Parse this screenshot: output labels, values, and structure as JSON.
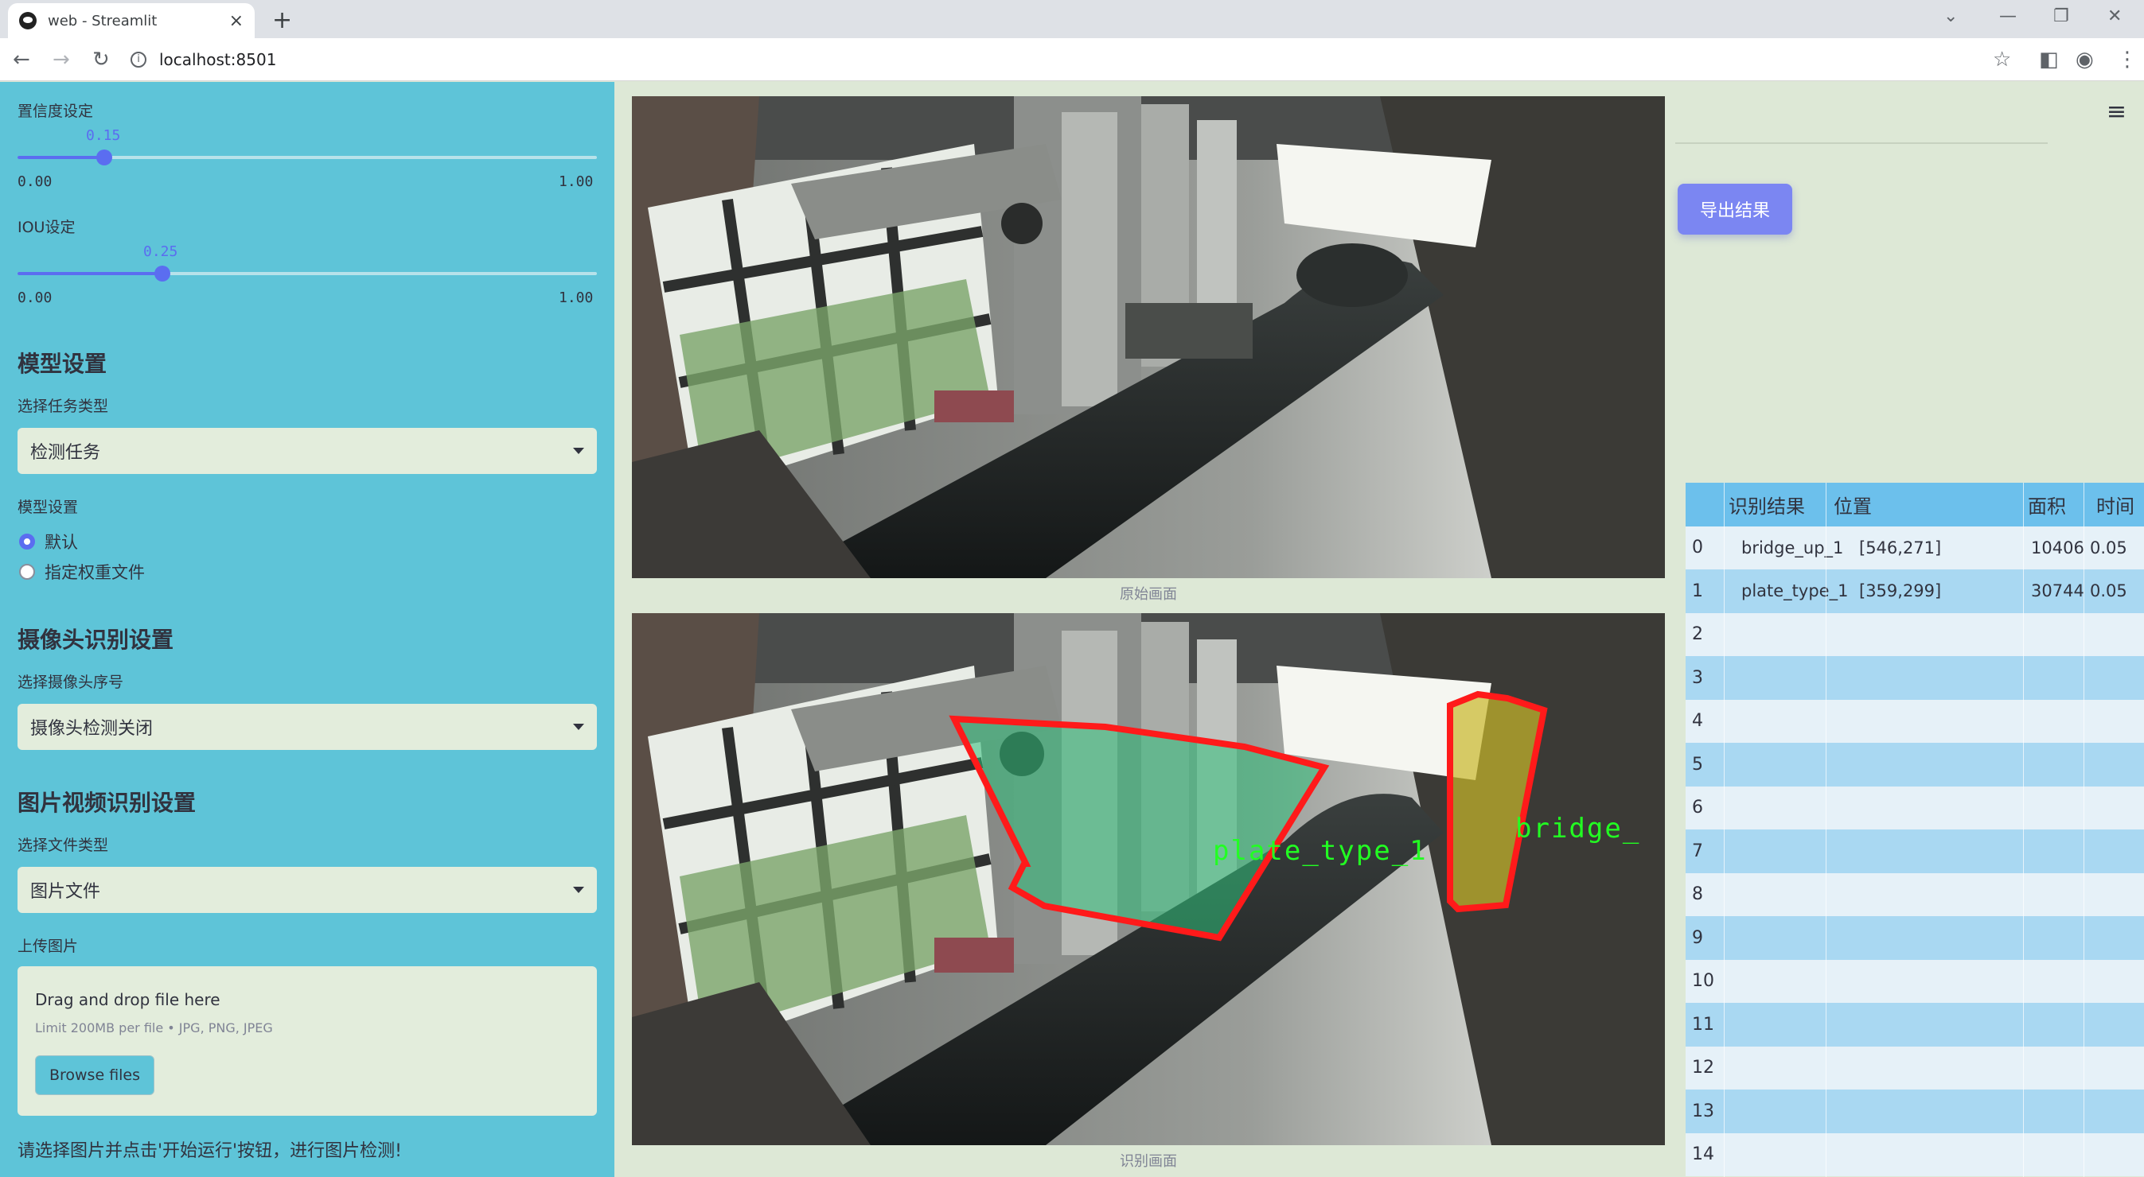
{
  "browser": {
    "tab_title": "web - Streamlit",
    "url": "localhost:8501"
  },
  "sidebar": {
    "confidence": {
      "label": "置信度设定",
      "value_label": "0.15",
      "value": 0.15,
      "min": "0.00",
      "max": "1.00"
    },
    "iou": {
      "label": "IOU设定",
      "value_label": "0.25",
      "value": 0.25,
      "min": "0.00",
      "max": "1.00"
    },
    "model_heading": "模型设置",
    "task_label": "选择任务类型",
    "task_value": "检测任务",
    "model_label": "模型设置",
    "model_options": [
      "默认",
      "指定权重文件"
    ],
    "camera_heading": "摄像头识别设置",
    "camera_label": "选择摄像头序号",
    "camera_value": "摄像头检测关闭",
    "media_heading": "图片视频识别设置",
    "filetype_label": "选择文件类型",
    "filetype_value": "图片文件",
    "upload_label": "上传图片",
    "upload_drag": "Drag and drop file here",
    "upload_limit": "Limit 200MB per file • JPG, PNG, JPEG",
    "browse_label": "Browse files",
    "hint": "请选择图片并点击'开始运行'按钮，进行图片检测!"
  },
  "main": {
    "original_caption": "原始画面",
    "result_caption": "识别画面",
    "export_label": "导出结果",
    "detections": [
      {
        "label": "plate_type_1"
      },
      {
        "label": "bridge_"
      }
    ]
  },
  "table": {
    "headers": [
      "识别结果",
      "位置",
      "面积",
      "时间"
    ],
    "rows": [
      {
        "idx": "0",
        "name": "bridge_up_1",
        "pos": "[546,271]",
        "area": "10406",
        "time": "0.05"
      },
      {
        "idx": "1",
        "name": "plate_type_1",
        "pos": "[359,299]",
        "area": "30744",
        "time": "0.05"
      },
      {
        "idx": "2"
      },
      {
        "idx": "3"
      },
      {
        "idx": "4"
      },
      {
        "idx": "5"
      },
      {
        "idx": "6"
      },
      {
        "idx": "7"
      },
      {
        "idx": "8"
      },
      {
        "idx": "9"
      },
      {
        "idx": "10"
      },
      {
        "idx": "11"
      },
      {
        "idx": "12"
      },
      {
        "idx": "13"
      },
      {
        "idx": "14"
      }
    ]
  },
  "colors": {
    "sidebar_bg": "#5ec4d8",
    "accent": "#5b6df0",
    "export_button": "#7b86f2",
    "box_outline": "#ff1a1a",
    "label_green": "#22ff22"
  }
}
